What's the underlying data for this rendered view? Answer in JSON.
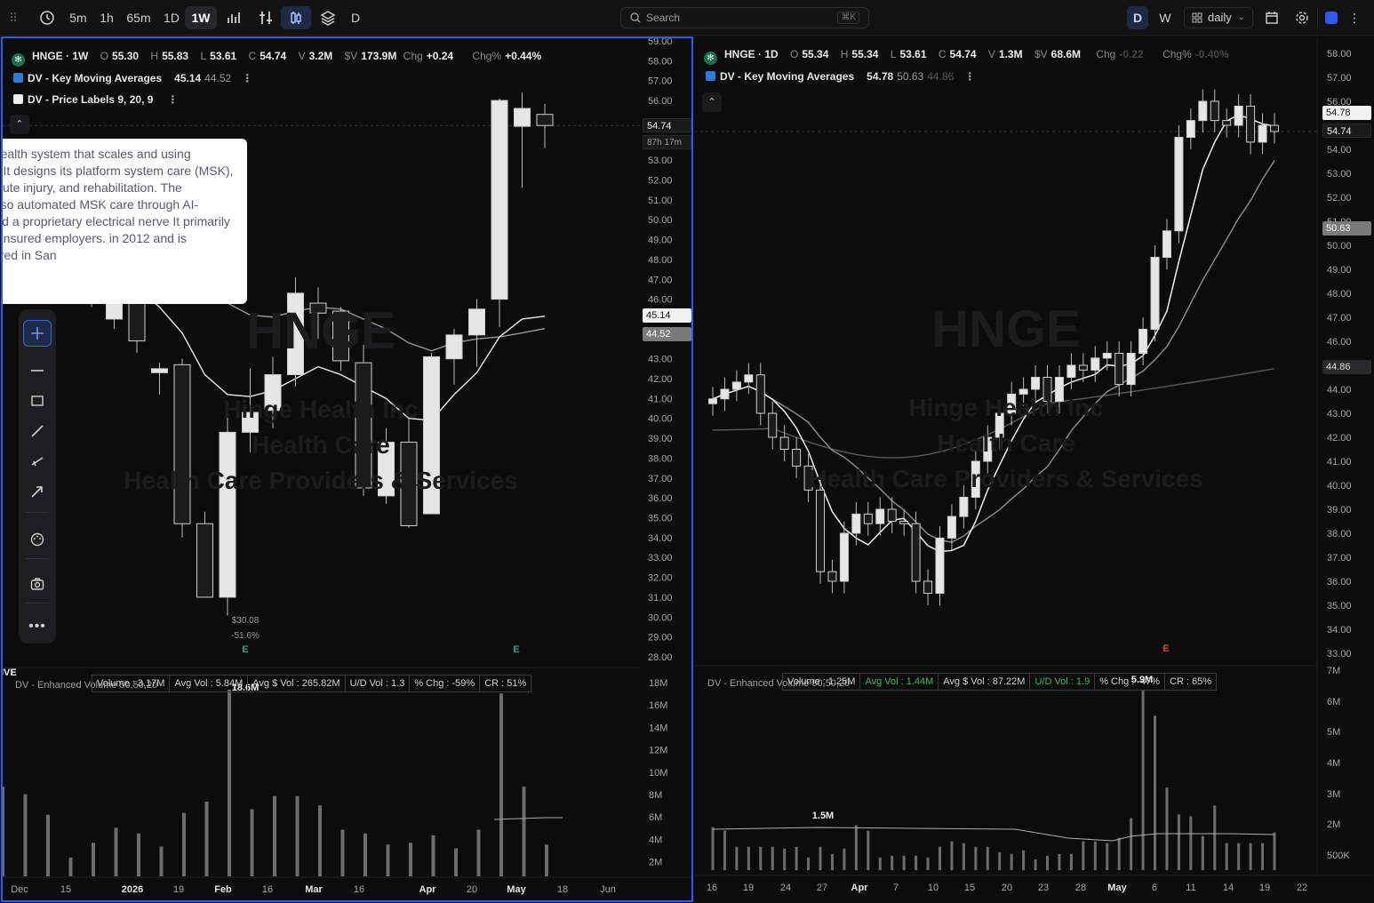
{
  "toolbar": {
    "intervals": [
      "5m",
      "1h",
      "65m",
      "1D",
      "1W"
    ],
    "active_interval": "1W",
    "symbol_d": "D",
    "search_placeholder": "Search",
    "search_shortcut": "⌘K",
    "period_d": "D",
    "period_w": "W",
    "layout_value": "daily",
    "accent": "#2b5bf0"
  },
  "left": {
    "legend": {
      "symbol": "HNGE · 1W",
      "o_label": "O",
      "o": "55.30",
      "h_label": "H",
      "h": "55.83",
      "l_label": "L",
      "l": "53.61",
      "c_label": "C",
      "c": "54.74",
      "v_label": "V",
      "v": "3.2M",
      "dv_label": "$V",
      "dv": "173.9M",
      "chg_label": "Chg",
      "chg": "+0.24",
      "chgp_label": "Chg%",
      "chgp": "+0.44%"
    },
    "ind1": {
      "name": "DV - Key Moving Averages",
      "v1": "45.14",
      "v2": "44.52"
    },
    "ind2": {
      "name": "DV - Price Labels 9, 20, 9"
    },
    "watermark": {
      "ticker": "HNGE",
      "name": "Hinge Health Inc",
      "sector": "Health Care",
      "industry": "Health Care Providers & Services"
    },
    "description": "building a health system that scales and using technology. It designs its platform system care (MSK), including acute injury, and rehabilitation. The company also automated MSK care through AI-powered and a proprietary electrical nerve It primarily serves self-insured employers. in 2012 and is headquartered in San",
    "price_labels": [
      "59.00",
      "58.00",
      "57.00",
      "56.00",
      "54.74",
      "53.00",
      "52.00",
      "51.00",
      "50.00",
      "49.00",
      "48.00",
      "47.00",
      "46.00",
      "45.14",
      "44.52",
      "43.00",
      "42.00",
      "41.00",
      "40.00",
      "39.00",
      "38.00",
      "37.00",
      "36.00",
      "35.00",
      "34.00",
      "33.00",
      "32.00",
      "31.00",
      "30.00",
      "29.00",
      "28.00"
    ],
    "last_price": "54.74",
    "countdown": "87h 17m",
    "ma1_price": "45.14",
    "ma2_price": "44.52",
    "low_label": "$30.08",
    "low_pct": "-51.6%",
    "earnings_marker": "E",
    "live_label": "IVE",
    "vol_caption": "DV - Enhanced Volume 50,50,20",
    "vol_stats": [
      "Volume : 3.17M",
      "Avg Vol : 5.84M",
      "Avg $ Vol : 265.82M",
      "U/D Vol : 1.3",
      "% Chg : -59%",
      "CR : 51%"
    ],
    "vol_peak_label": "18.6M",
    "vol_axis": [
      "18M",
      "16M",
      "14M",
      "12M",
      "10M",
      "8M",
      "6M",
      "4M",
      "2M"
    ],
    "dates": [
      "Dec",
      "15",
      "2026",
      "19",
      "Feb",
      "16",
      "Mar",
      "16",
      "Apr",
      "20",
      "May",
      "18",
      "Jun"
    ],
    "bold_dates": [
      "2026",
      "Feb",
      "Mar",
      "Apr",
      "May"
    ]
  },
  "right": {
    "legend": {
      "symbol": "HNGE · 1D",
      "o_label": "O",
      "o": "55.34",
      "h_label": "H",
      "h": "55.34",
      "l_label": "L",
      "l": "53.61",
      "c_label": "C",
      "c": "54.74",
      "v_label": "V",
      "v": "1.3M",
      "dv_label": "$V",
      "dv": "68.6M",
      "chg_label": "Chg",
      "chg": "-0.22",
      "chgp_label": "Chg%",
      "chgp": "-0.40%"
    },
    "ind1": {
      "name": "DV - Key Moving Averages",
      "v1": "54.78",
      "v2": "50.63",
      "v3": "44.86"
    },
    "watermark": {
      "ticker": "HNGE",
      "name": "Hinge Health Inc",
      "sector": "Health Care",
      "industry": "Health Care Providers & Services"
    },
    "price_labels": [
      "58.00",
      "57.00",
      "56.00",
      "54.78",
      "54.74",
      "54.00",
      "53.00",
      "52.00",
      "51.00",
      "50.63",
      "50.00",
      "49.00",
      "48.00",
      "47.00",
      "46.00",
      "44.86",
      "44.00",
      "43.00",
      "42.00",
      "41.00",
      "40.00",
      "39.00",
      "38.00",
      "37.00",
      "36.00",
      "35.00",
      "34.00",
      "33.00"
    ],
    "ma1_price": "54.78",
    "last_price": "54.74",
    "ma2_price": "50.63",
    "ma3_price": "44.86",
    "earnings_marker": "E",
    "vol_caption": "DV - Enhanced Volume 50,50,20",
    "vol_stats": [
      "Volume : 1.25M",
      "Avg Vol : 1.44M",
      "Avg $ Vol : 87.22M",
      "U/D Vol : 1.9",
      "% Chg : -47%",
      "CR : 65%"
    ],
    "vol_peak_label": "5.9M",
    "vol_low_label": "1.5M",
    "vol_axis": [
      "7M",
      "6M",
      "5M",
      "4M",
      "3M",
      "2M",
      "500K"
    ],
    "dates": [
      "16",
      "19",
      "24",
      "27",
      "Apr",
      "7",
      "10",
      "15",
      "20",
      "23",
      "28",
      "May",
      "6",
      "11",
      "14",
      "19",
      "22"
    ],
    "bold_dates": [
      "Apr",
      "May"
    ]
  },
  "chart_data": [
    {
      "type": "candlestick",
      "title": "HNGE · 1W",
      "x": [
        "Dec 1",
        "Dec 8",
        "Dec 15",
        "Dec 22",
        "Dec 29",
        "Jan 5",
        "Jan 12",
        "Jan 19",
        "Jan 26",
        "Feb 2",
        "Feb 9",
        "Feb 16",
        "Feb 23",
        "Mar 2",
        "Mar 9",
        "Mar 16",
        "Mar 23",
        "Mar 30",
        "Apr 6",
        "Apr 13",
        "Apr 20",
        "Apr 27",
        "May 4",
        "May 11",
        "May 18"
      ],
      "ohlc": [
        [
          null,
          null,
          null,
          null
        ],
        [
          null,
          null,
          null,
          null
        ],
        [
          null,
          null,
          null,
          null
        ],
        [
          null,
          null,
          null,
          null
        ],
        [
          46.2,
          46.8,
          45.6,
          45.8
        ],
        [
          45.0,
          46.2,
          44.5,
          46.0
        ],
        [
          46.0,
          47.3,
          43.3,
          43.9
        ],
        [
          42.3,
          42.8,
          41.2,
          42.5
        ],
        [
          42.7,
          43.0,
          34.0,
          34.7
        ],
        [
          34.7,
          35.3,
          31.0,
          31.0
        ],
        [
          31.0,
          40.5,
          30.08,
          39.3
        ],
        [
          39.3,
          42.5,
          38.3,
          40.3
        ],
        [
          40.4,
          43.1,
          39.5,
          42.2
        ],
        [
          42.2,
          47.1,
          41.6,
          46.3
        ],
        [
          45.8,
          46.6,
          44.0,
          45.3
        ],
        [
          45.4,
          45.6,
          42.4,
          42.9
        ],
        [
          42.8,
          43.7,
          36.1,
          36.5
        ],
        [
          36.1,
          39.5,
          35.7,
          38.8
        ],
        [
          38.8,
          40.2,
          34.5,
          34.6
        ],
        [
          35.2,
          43.3,
          35.2,
          43.1
        ],
        [
          43.0,
          44.5,
          41.7,
          44.2
        ],
        [
          44.2,
          46.0,
          42.6,
          45.5
        ],
        [
          46.0,
          56.1,
          44.6,
          56.0
        ],
        [
          54.7,
          56.4,
          51.6,
          55.6
        ],
        [
          55.3,
          55.83,
          53.61,
          54.74
        ]
      ],
      "ma_fast_last": 45.14,
      "ma_slow_last": 44.52,
      "ylim": [
        28,
        59
      ],
      "volume_peak": "18.6M"
    },
    {
      "type": "candlestick",
      "title": "HNGE · 1D",
      "x": [
        "Mar 13",
        "Mar 16",
        "Mar 17",
        "Mar 18",
        "Mar 19",
        "Mar 20",
        "Mar 23",
        "Mar 24",
        "Mar 25",
        "Mar 26",
        "Mar 27",
        "Mar 30",
        "Mar 31",
        "Apr 1",
        "Apr 2",
        "Apr 6",
        "Apr 7",
        "Apr 8",
        "Apr 9",
        "Apr 10",
        "Apr 13",
        "Apr 14",
        "Apr 15",
        "Apr 16",
        "Apr 17",
        "Apr 20",
        "Apr 21",
        "Apr 22",
        "Apr 23",
        "Apr 24",
        "Apr 27",
        "Apr 28",
        "Apr 29",
        "Apr 30",
        "May 1",
        "May 4",
        "May 5",
        "May 6",
        "May 7",
        "May 8",
        "May 11",
        "May 12",
        "May 13",
        "May 14",
        "May 15",
        "May 18",
        "May 19",
        "May 20"
      ],
      "close": [
        43.6,
        44.0,
        44.3,
        44.6,
        43.0,
        42.0,
        41.5,
        40.8,
        39.8,
        36.4,
        36.0,
        38.0,
        38.8,
        38.4,
        39.0,
        38.5,
        38.4,
        36.0,
        35.5,
        37.8,
        38.7,
        39.5,
        41.0,
        42.0,
        43.0,
        43.8,
        44.0,
        44.5,
        43.5,
        44.5,
        45.0,
        44.8,
        45.3,
        45.5,
        44.2,
        45.5,
        46.5,
        49.5,
        50.6,
        54.5,
        55.2,
        56.0,
        55.2,
        55.0,
        55.8,
        54.3,
        55.0,
        54.74
      ],
      "ma_lines_last": [
        54.78,
        50.63,
        44.86
      ],
      "ylim": [
        33,
        58
      ],
      "volume_peak": "5.9M"
    }
  ]
}
